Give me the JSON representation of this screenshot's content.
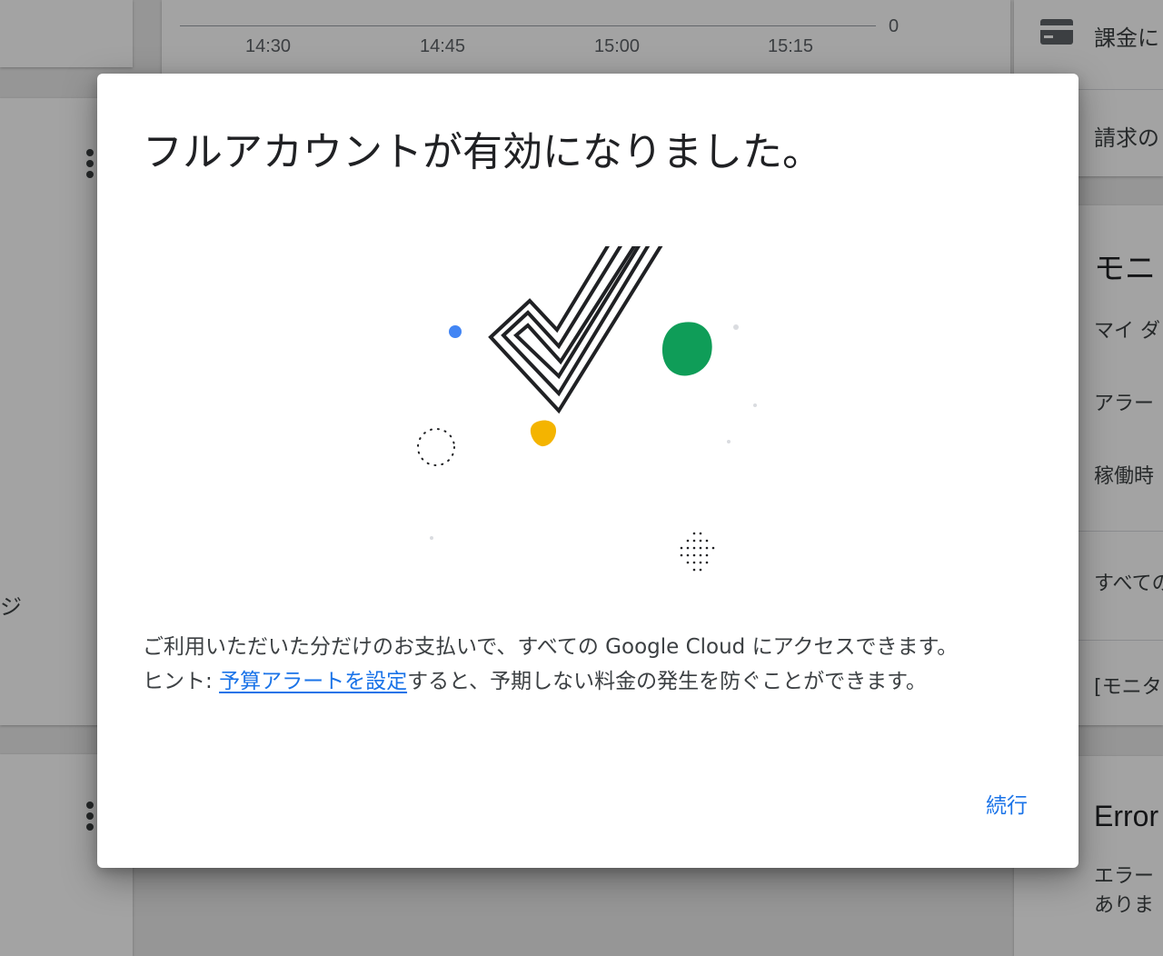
{
  "background": {
    "chart": {
      "ticks": [
        "14:30",
        "14:45",
        "15:00",
        "15:15"
      ],
      "zero_label": "0"
    },
    "left_fragment": "ジ",
    "right_panel": {
      "billing_link": "課金に",
      "billing_account": "請求の",
      "monitoring_title": "モニ",
      "links": [
        "マイ ダ",
        "アラー",
        "稼働時"
      ],
      "all_link": "すべての",
      "monitoring_link": "[モニタ",
      "error_title": "Error",
      "error_text_1": "エラー",
      "error_text_2": "ありま"
    }
  },
  "dialog": {
    "title": "フルアカウントが有効になりました。",
    "line1": "ご利用いただいた分だけのお支払いで、すべての Google Cloud にアクセスできます。",
    "hint_prefix": "ヒント: ",
    "hint_link": "予算アラートを設定",
    "hint_suffix": "すると、予期しない料金の発生を防ぐことができます。",
    "continue_label": "続行",
    "colors": {
      "red": "#db4437",
      "blue": "#4285f4",
      "green": "#0f9d58",
      "yellow": "#f4b400",
      "link": "#1a73e8"
    }
  }
}
